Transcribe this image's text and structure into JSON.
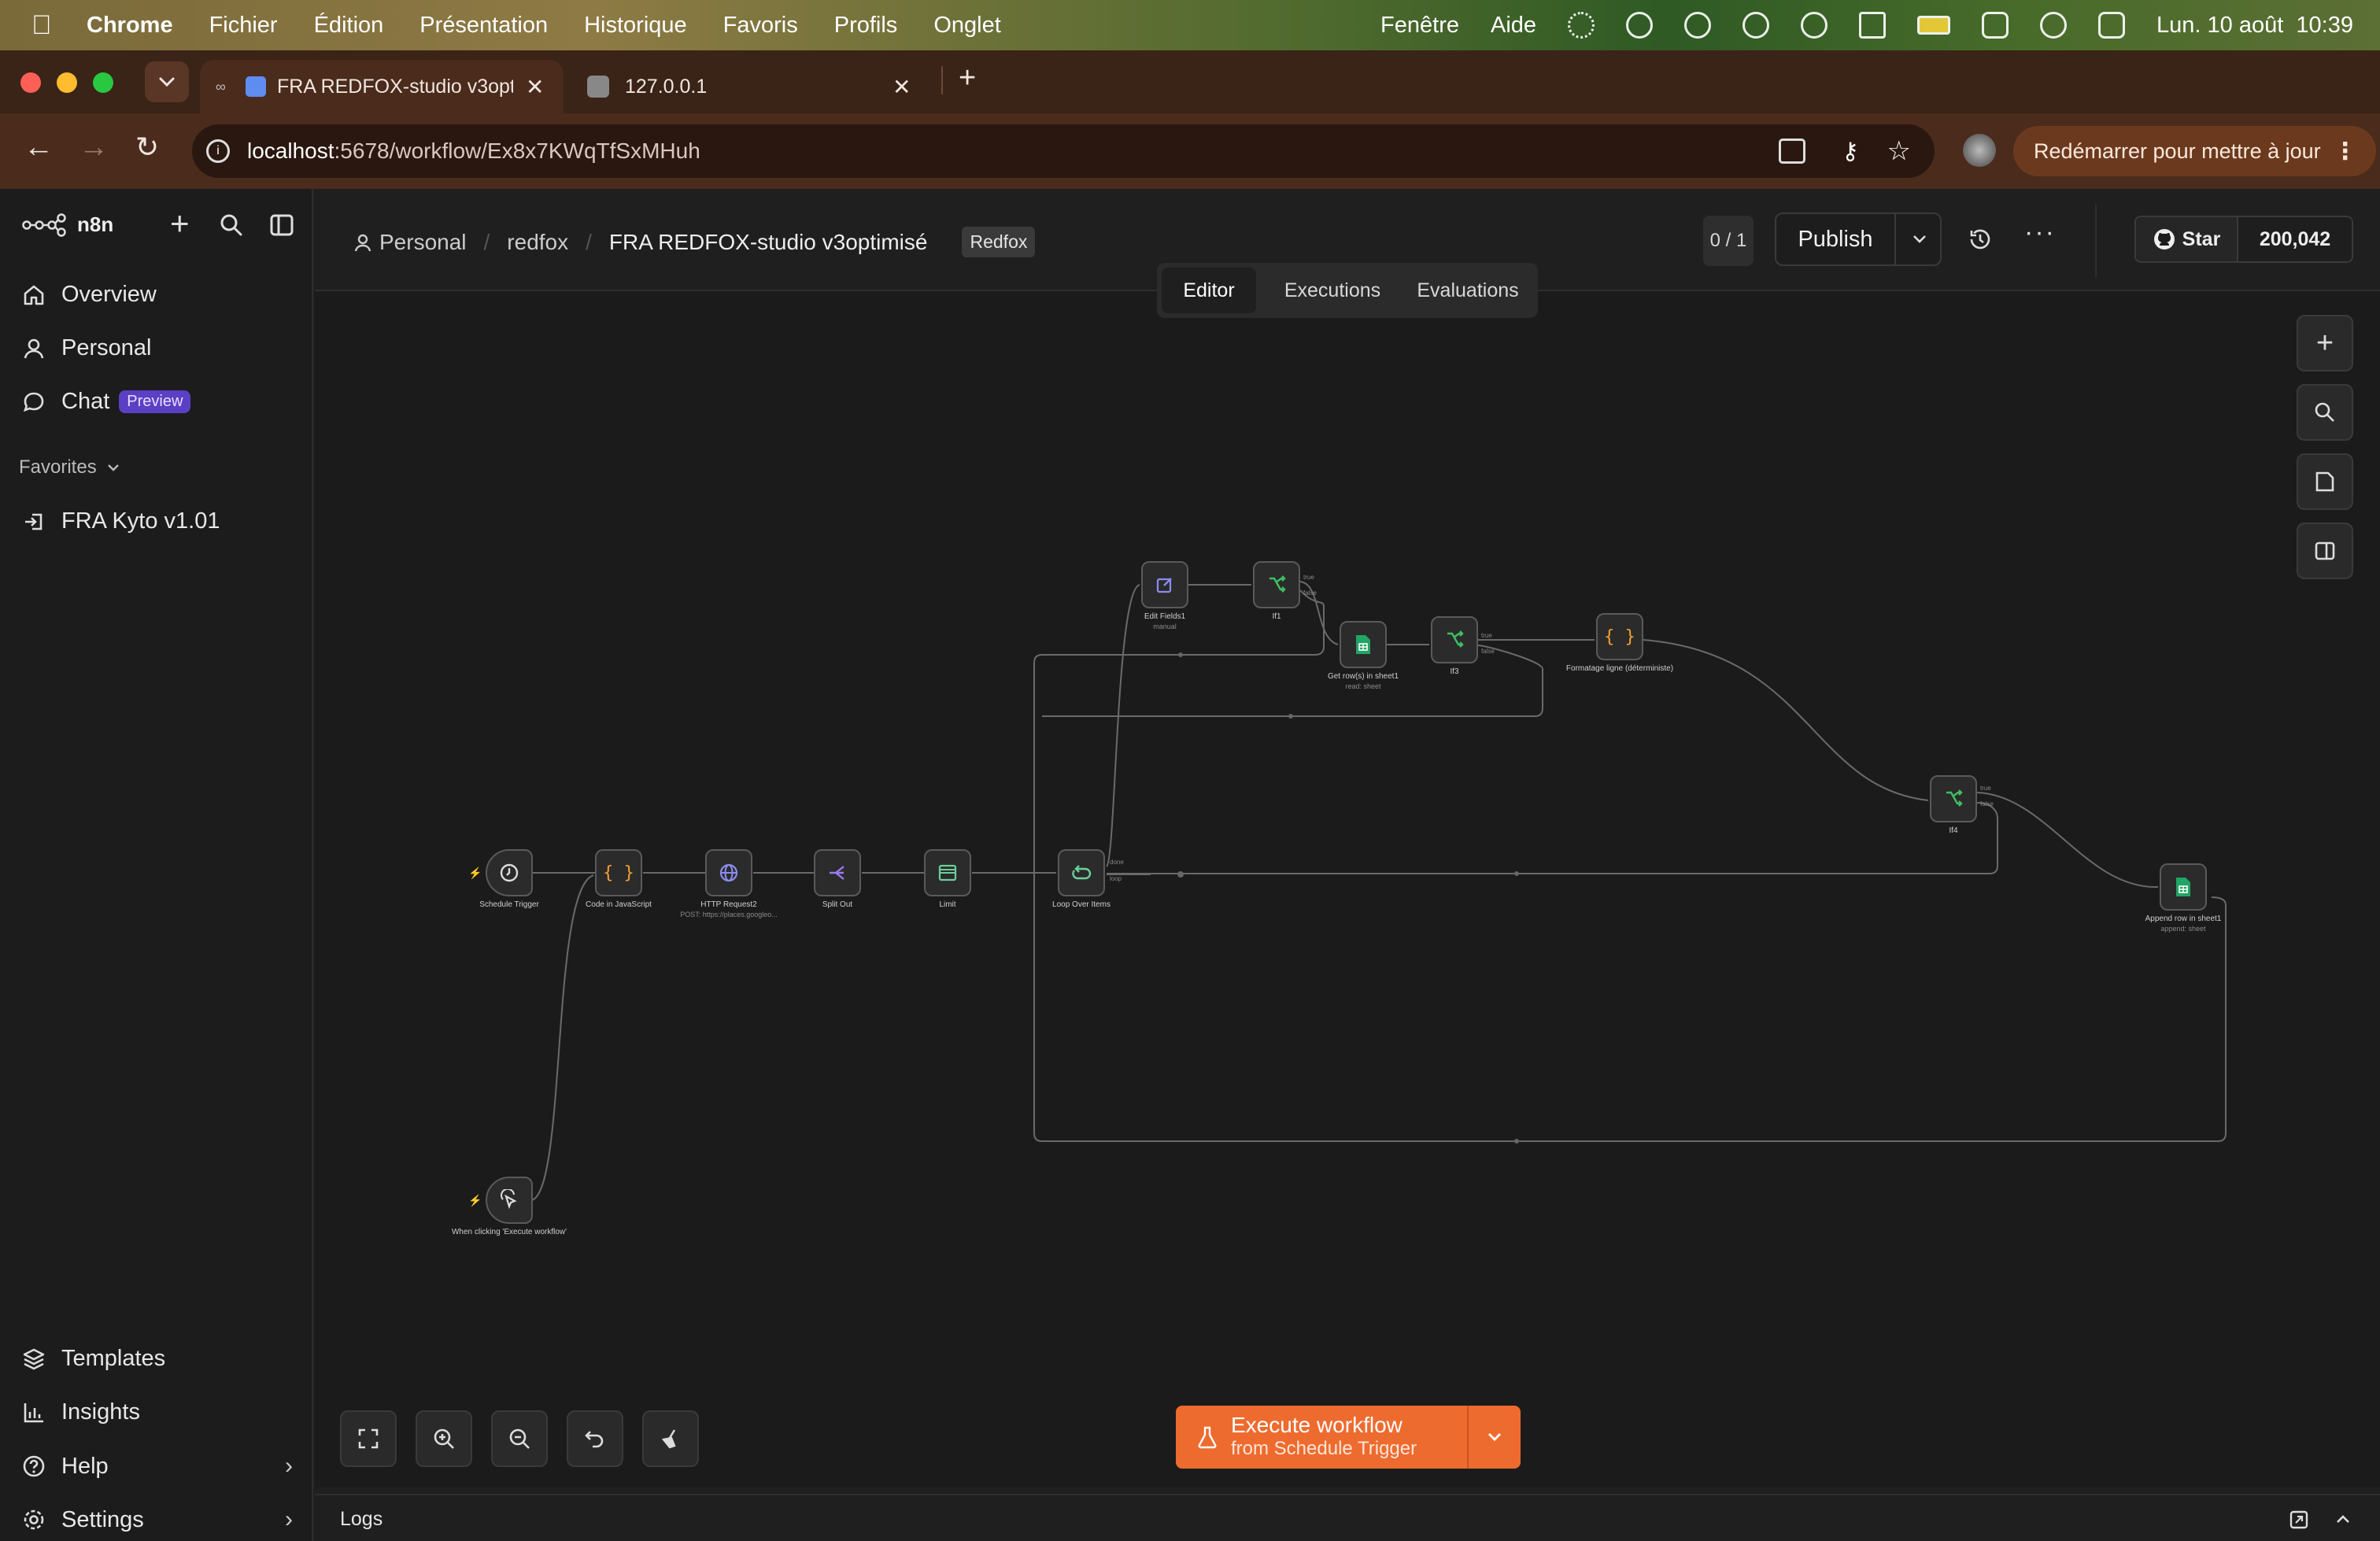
{
  "menubar": {
    "app_name": "Chrome",
    "items": [
      "Fichier",
      "Édition",
      "Présentation",
      "Historique",
      "Favoris",
      "Profils",
      "Onglet"
    ],
    "right_items": [
      "Fenêtre",
      "Aide"
    ],
    "datetime": "Lun. 10 août  10:39"
  },
  "browser": {
    "tabs": [
      {
        "title": "FRA REDFOX-studio v3opt",
        "active": true
      },
      {
        "title": "127.0.0.1",
        "active": false
      }
    ],
    "url_host": "localhost",
    "url_path": ":5678/workflow/Ex8x7KWqTfSxMHuh",
    "restart_label": "Redémarrer pour mettre à jour"
  },
  "sidebar": {
    "brand": "n8n",
    "nav": [
      {
        "label": "Overview",
        "icon": "home-icon"
      },
      {
        "label": "Personal",
        "icon": "user-icon"
      },
      {
        "label": "Chat",
        "icon": "chat-icon",
        "badge": "Preview"
      }
    ],
    "favorites_label": "Favorites",
    "favorites": [
      {
        "label": "FRA Kyto v1.01",
        "icon": "workflow-icon"
      }
    ],
    "bottom": [
      {
        "label": "Templates",
        "icon": "templates-icon"
      },
      {
        "label": "Insights",
        "icon": "insights-icon"
      },
      {
        "label": "Help",
        "icon": "help-icon"
      },
      {
        "label": "Settings",
        "icon": "settings-icon"
      }
    ]
  },
  "header": {
    "breadcrumb": [
      "Personal",
      "redfox",
      "FRA REDFOX-studio v3optimisé"
    ],
    "tag": "Redfox",
    "counter": "0 / 1",
    "publish_label": "Publish",
    "github_star_label": "Star",
    "github_stars": "200,042",
    "tabs": [
      "Editor",
      "Executions",
      "Evaluations"
    ],
    "active_tab": "Editor"
  },
  "workflow": {
    "nodes": [
      {
        "name": "Schedule Trigger",
        "sub": ""
      },
      {
        "name": "Code in JavaScript",
        "sub": ""
      },
      {
        "name": "HTTP Request2",
        "sub": "POST: https://places.googleo..."
      },
      {
        "name": "Split Out",
        "sub": ""
      },
      {
        "name": "Limit",
        "sub": ""
      },
      {
        "name": "Loop Over Items",
        "sub": ""
      },
      {
        "name": "Edit Fields1",
        "sub": "manual"
      },
      {
        "name": "If1",
        "sub": ""
      },
      {
        "name": "Get row(s) in sheet1",
        "sub": "read: sheet"
      },
      {
        "name": "If3",
        "sub": ""
      },
      {
        "name": "Formatage ligne (déterministe)",
        "sub": ""
      },
      {
        "name": "If4",
        "sub": ""
      },
      {
        "name": "Append row in sheet1",
        "sub": "append: sheet"
      },
      {
        "name": "When clicking 'Execute workflow'",
        "sub": ""
      }
    ],
    "port_labels": {
      "loop_done": "done",
      "loop_loop": "loop",
      "true": "true",
      "false": "false"
    }
  },
  "execute": {
    "title": "Execute workflow",
    "subtitle": "from Schedule Trigger"
  },
  "logs_label": "Logs",
  "colors": {
    "accent": "#ee6b2f",
    "canvas_bg": "#1b1b1b",
    "preview_badge": "#7c5cff",
    "sheet_green": "#21a464",
    "if_green": "#2fa84f"
  }
}
